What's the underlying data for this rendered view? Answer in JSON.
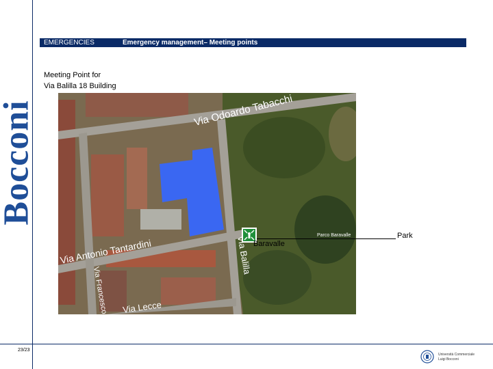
{
  "logo": {
    "text": "Bocconi",
    "color": "#1f4e98"
  },
  "header": {
    "section": "EMERGENCIES",
    "title": "Emergency management– Meeting points",
    "bar_color": "#0a2a66"
  },
  "meeting_point": {
    "title_line1": "Meeting Point for",
    "title_line2": "Via Balilla 18 Building"
  },
  "map": {
    "streets": [
      "Via Odoardo Tabacchi",
      "Via Antonio Tantardini",
      "Via Balilla",
      "Via Lecce",
      "Via Francesco"
    ],
    "park_map_label": "Parco Baravalle",
    "building_color": "#3a67f2",
    "meeting_point_icon": "assembly-point-icon"
  },
  "labels": {
    "park": "Park",
    "baravalle": "Baravalle"
  },
  "footer": {
    "page": "23/23",
    "org_line1": "Università Commerciale",
    "org_line2": "Luigi Bocconi"
  }
}
